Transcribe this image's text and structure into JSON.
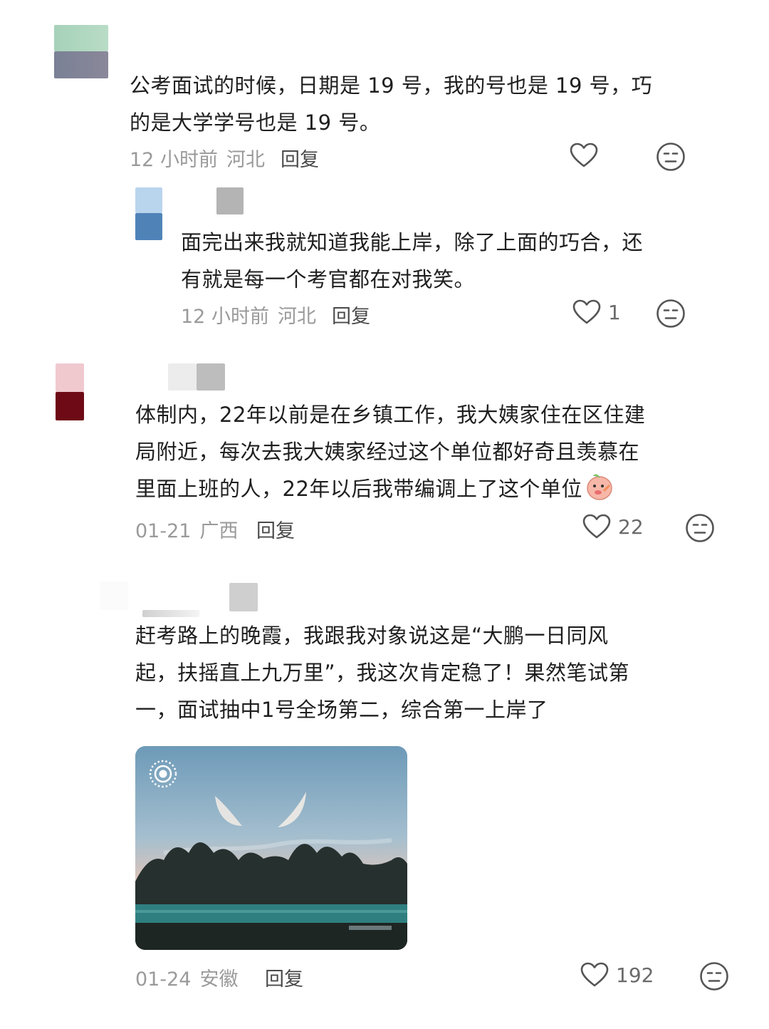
{
  "comments": [
    {
      "lines": [
        "公考面试的时候，日期是 19 号，我的号也是 19 号，巧",
        "的是大学学号也是 19 号。"
      ],
      "time": "12 小时前",
      "location": "河北",
      "reply_label": "回复",
      "likes": ""
    },
    {
      "lines": [
        "面完出来我就知道我能上岸，除了上面的巧合，还",
        "有就是每一个考官都在对我笑。"
      ],
      "time": "12 小时前",
      "location": "河北",
      "reply_label": "回复",
      "likes": "1"
    },
    {
      "lines": [
        "体制内，22年以前是在乡镇工作，我大姨家住在区住建",
        "局附近，每次去我大姨家经过这个单位都好奇且羡慕在",
        "里面上班的人，22年以后我带编调上了这个单位"
      ],
      "time": "01-21",
      "location": "广西",
      "reply_label": "回复",
      "likes": "22",
      "emoji": "peach-sticker"
    },
    {
      "lines": [
        "赶考路上的晚霞，我跟我对象说这是“大鹏一日同风",
        "起，扶摇直上九万里”，我这次肯定稳了！果然笔试第",
        "一，面试抽中1号全场第二，综合第一上岸了"
      ],
      "time": "01-24",
      "location": "安徽",
      "reply_label": "回复",
      "likes": "192",
      "photo": "sunset-sky-photo"
    }
  ],
  "icons": {
    "like": "heart-outline-icon",
    "react": "neutral-face-icon",
    "live": "live-photo-icon"
  },
  "colors": {
    "text": "#1f1f1f",
    "meta": "#9a9a9a",
    "icon": "#555555"
  }
}
